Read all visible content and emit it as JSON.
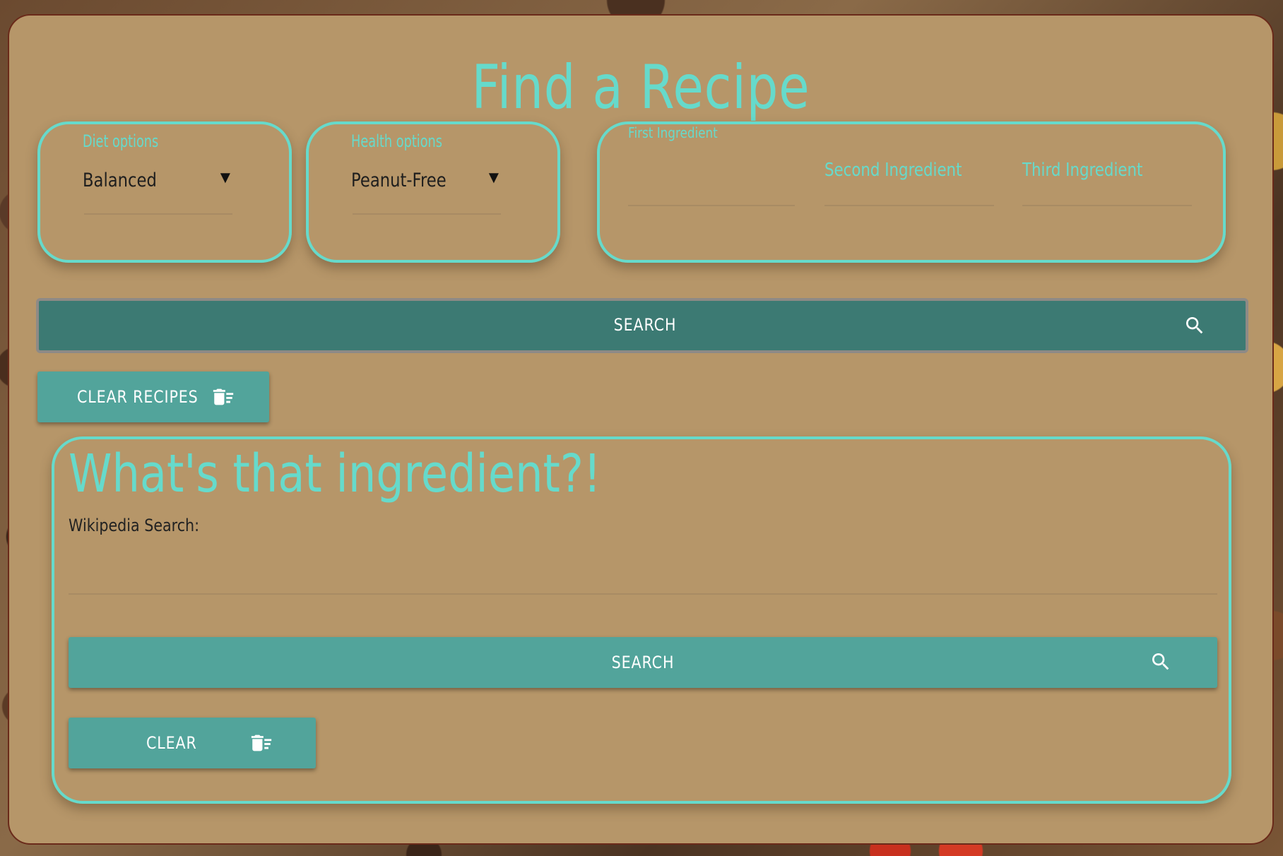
{
  "title": "Find a Recipe",
  "diet": {
    "label": "Diet options",
    "value": "Balanced"
  },
  "health": {
    "label": "Health options",
    "value": "Peanut-Free"
  },
  "ingredients": {
    "first": "First Ingredient",
    "second": "Second Ingredient",
    "third": "Third Ingredient"
  },
  "search_button": {
    "label": "SEARCH"
  },
  "clear_recipes_button": {
    "label": "CLEAR RECIPES"
  },
  "wiki": {
    "title": "What's that ingredient?!",
    "label": "Wikipedia Search:",
    "search_label": "SEARCH",
    "clear_label": "CLEAR"
  },
  "icons": {
    "search": "search-icon",
    "clear": "delete-sweep-icon",
    "dropdown": "dropdown-arrow-icon"
  },
  "colors": {
    "accent": "#66dacb",
    "panel": "#b69669",
    "search_bg": "#3c7a73",
    "button_bg": "#52a49b"
  }
}
